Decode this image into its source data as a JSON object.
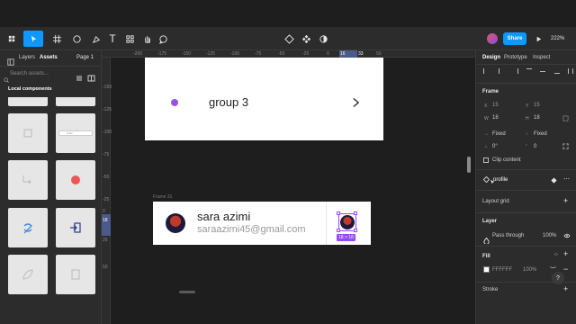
{
  "toolbar": {
    "share_label": "Share",
    "zoom": "222%"
  },
  "left_panel": {
    "tabs": [
      "Layers",
      "Assets"
    ],
    "page_label": "Page 1",
    "search_placeholder": "Search assets...",
    "section_title": "Local components",
    "thumb_pill_text": "Hello"
  },
  "canvas": {
    "ruler_h": [
      "-200",
      "-175",
      "-150",
      "-125",
      "-100",
      "-75",
      "-50",
      "-25",
      "0",
      "16",
      "33",
      "50"
    ],
    "ruler_v": [
      "-150",
      "-125",
      "-100",
      "-75",
      "-50",
      "-25",
      "0",
      "18",
      "25",
      "50"
    ],
    "group_card": {
      "title": "group 3"
    },
    "frame_label": "Frame 31",
    "profile_card": {
      "name": "sara azimi",
      "email": "saraazimi45@gmail.com",
      "selection_size": "18 × 18"
    }
  },
  "right_panel": {
    "tabs": [
      "Design",
      "Prototype",
      "Inspect"
    ],
    "frame_label": "Frame",
    "x_label": "X",
    "x_value": "15",
    "y_label": "Y",
    "y_value": "15",
    "w_label": "W",
    "w_value": "18",
    "h_label": "H",
    "h_value": "18",
    "fixed_w": "Fixed",
    "fixed_h": "Fixed",
    "rotation": "0°",
    "radius": "0",
    "clip_content": "Clip content",
    "component_name": "profile",
    "layout_grid": "Layout grid",
    "layer_label": "Layer",
    "blend_mode": "Pass through",
    "opacity": "100%",
    "fill_label": "Fill",
    "fill_hex": "FFFFFF",
    "fill_opacity": "100%",
    "stroke_label": "Stroke",
    "help": "?"
  },
  "colors": {
    "accent": "#0d99ff",
    "purple_dot": "#9b51e0",
    "selection": "#9747ff",
    "red_dot": "#eb5757"
  }
}
